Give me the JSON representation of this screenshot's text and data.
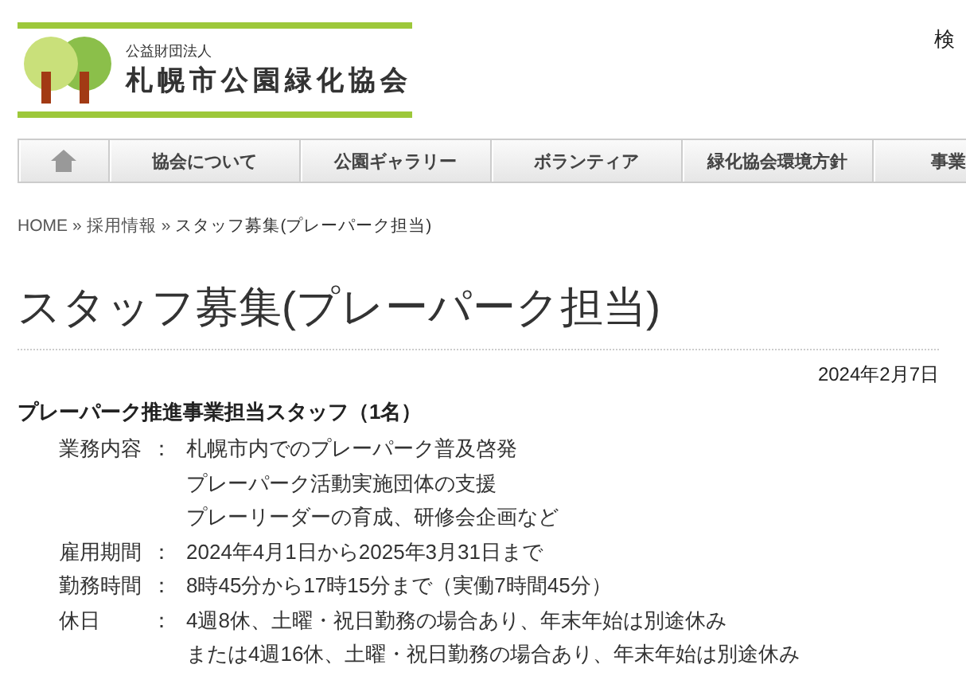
{
  "header": {
    "org_type": "公益財団法人",
    "org_name": "札幌市公園緑化協会",
    "search_label": "検"
  },
  "nav": [
    {
      "kind": "home"
    },
    {
      "kind": "text",
      "label": "協会について"
    },
    {
      "kind": "text",
      "label": "公園ギャラリー"
    },
    {
      "kind": "text",
      "label": "ボランティア"
    },
    {
      "kind": "text",
      "label": "緑化協会環境方針"
    },
    {
      "kind": "text",
      "label": "事業"
    }
  ],
  "breadcrumb": [
    {
      "kind": "link",
      "label": "HOME"
    },
    {
      "kind": "link",
      "label": "採用情報"
    },
    {
      "kind": "current",
      "label": "スタッフ募集(プレーパーク担当)"
    }
  ],
  "breadcrumb_separator": "»",
  "page_title": "スタッフ募集(プレーパーク担当)",
  "date": "2024年2月7日",
  "job_heading": "プレーパーク推進事業担当スタッフ（1名）",
  "details": [
    {
      "label": "業務内容",
      "colon": "：",
      "lines": [
        "札幌市内でのプレーパーク普及啓発",
        "プレーパーク活動実施団体の支援",
        "プレーリーダーの育成、研修会企画など"
      ]
    },
    {
      "label": "雇用期間",
      "colon": "：",
      "lines": [
        "2024年4月1日から2025年3月31日まで"
      ]
    },
    {
      "label": "勤務時間",
      "colon": "：",
      "lines": [
        "8時45分から17時15分まで（実働7時間45分）"
      ]
    },
    {
      "label": "休日",
      "colon": "：",
      "lines": [
        "4週8休、土曜・祝日勤務の場合あり、年末年始は別途休み",
        "または4週16休、土曜・祝日勤務の場合あり、年末年始は別途休み"
      ]
    }
  ]
}
